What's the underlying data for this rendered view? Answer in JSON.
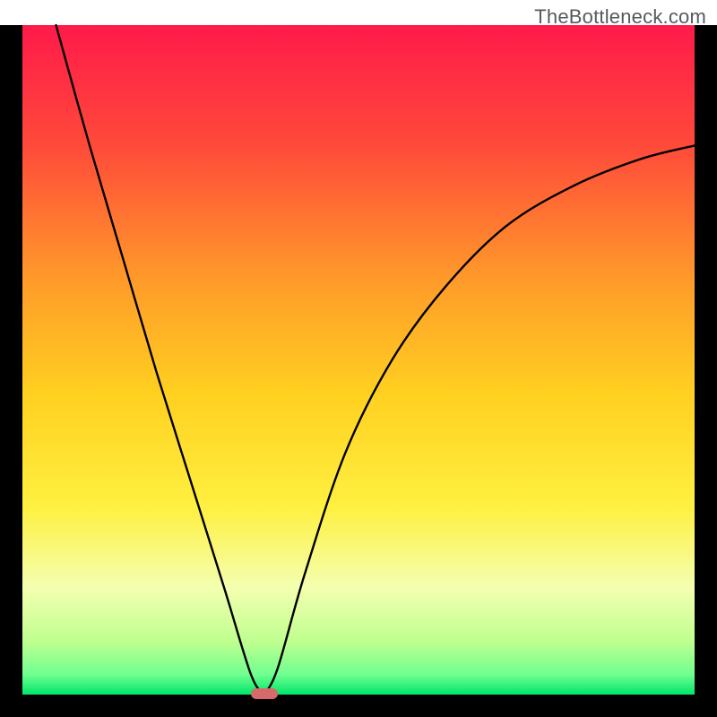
{
  "watermark": "TheBottleneck.com",
  "chart_data": {
    "type": "line",
    "title": "",
    "xlabel": "",
    "ylabel": "",
    "xlim": [
      0,
      100
    ],
    "ylim": [
      0,
      100
    ],
    "optimum_x": 36,
    "marker": {
      "x": 36,
      "y": 0,
      "color": "#d66a6a"
    },
    "frame": {
      "outer_width": 800,
      "outer_height": 800,
      "border": 25,
      "top_strip_white": true,
      "black_border_color": "#000000"
    },
    "gradient_stops": {
      "top": "#ff1a4a",
      "upper_mid": "#ff8a2a",
      "mid": "#ffe100",
      "lower_mid": "#f7ff60",
      "near_bottom": "#a8ff70",
      "bottom": "#00e66a"
    },
    "left_curve_points": [
      {
        "x": 5,
        "y": 100
      },
      {
        "x": 10,
        "y": 82
      },
      {
        "x": 15,
        "y": 65
      },
      {
        "x": 20,
        "y": 48
      },
      {
        "x": 25,
        "y": 32
      },
      {
        "x": 30,
        "y": 16
      },
      {
        "x": 34,
        "y": 3
      },
      {
        "x": 36,
        "y": 0
      }
    ],
    "right_curve_points": [
      {
        "x": 36,
        "y": 0
      },
      {
        "x": 38,
        "y": 4
      },
      {
        "x": 42,
        "y": 18
      },
      {
        "x": 48,
        "y": 36
      },
      {
        "x": 55,
        "y": 50
      },
      {
        "x": 63,
        "y": 61
      },
      {
        "x": 72,
        "y": 70
      },
      {
        "x": 82,
        "y": 76
      },
      {
        "x": 92,
        "y": 80
      },
      {
        "x": 100,
        "y": 82
      }
    ]
  }
}
